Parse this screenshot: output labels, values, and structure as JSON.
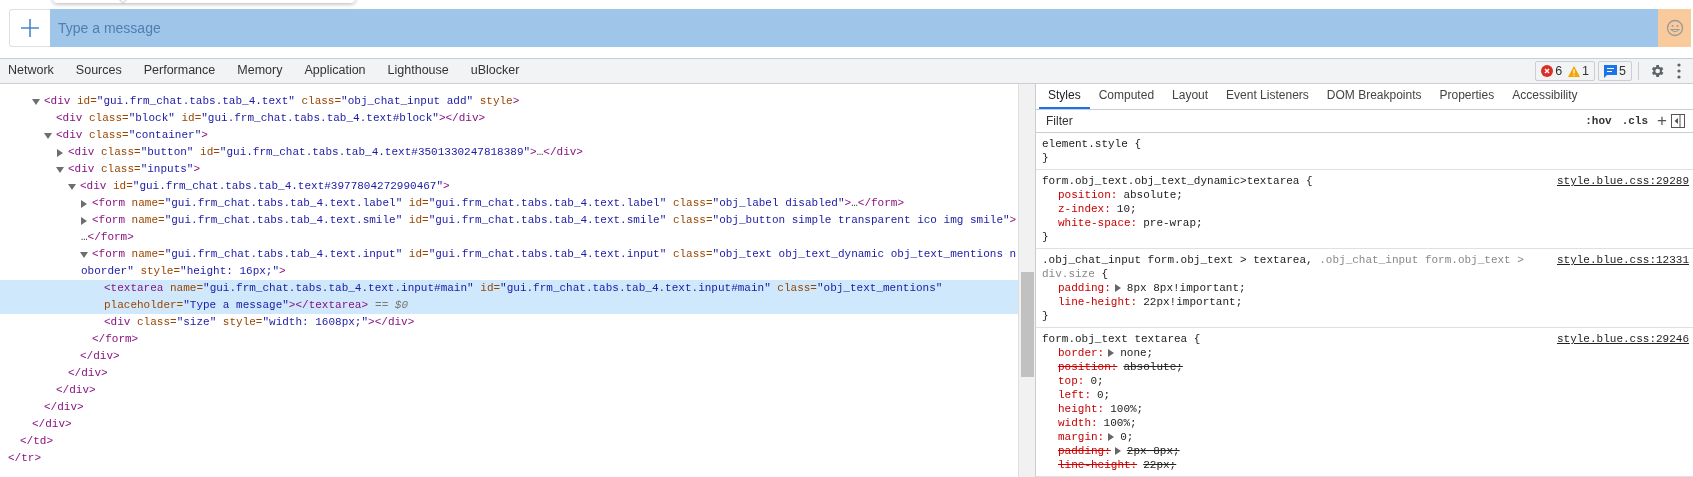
{
  "chat_bar": {
    "placeholder": "Type a message"
  },
  "devtools_tabs": [
    {
      "label": "Network",
      "selected": false
    },
    {
      "label": "Sources",
      "selected": false
    },
    {
      "label": "Performance",
      "selected": false
    },
    {
      "label": "Memory",
      "selected": false
    },
    {
      "label": "Application",
      "selected": false
    },
    {
      "label": "Lighthouse",
      "selected": false
    },
    {
      "label": "uBlocker",
      "selected": false
    }
  ],
  "issues": {
    "errors": "6",
    "warnings": "1",
    "messages": "5"
  },
  "dom_tree": [
    {
      "selected": false,
      "close": [
        [
          {
            "kind": "tag",
            "text": "</tr>"
          }
        ]
      ],
      "children": [
        {
          "selected": false,
          "close": [
            [
              {
                "kind": "tag",
                "text": "</td>"
              }
            ]
          ],
          "children": [
            {
              "selected": false,
              "close": [
                [
                  {
                    "kind": "tag",
                    "text": "</div>"
                  }
                ]
              ],
              "children": [
                {
                  "selected": false,
                  "expanded": true,
                  "open": [
                    [
                      {
                        "kind": "tag",
                        "text": "<div"
                      },
                      {
                        "kind": "attr",
                        "text": " id="
                      },
                      {
                        "kind": "value",
                        "text": "\"gui.frm_chat.tabs.tab_4.text\""
                      },
                      {
                        "kind": "attr",
                        "text": " class="
                      },
                      {
                        "kind": "value",
                        "text": "\"obj_chat_input add\""
                      },
                      {
                        "kind": "attr",
                        "text": " style"
                      },
                      {
                        "kind": "tag",
                        "text": ">"
                      }
                    ]
                  ],
                  "close": [
                    [
                      {
                        "kind": "tag",
                        "text": "</div>"
                      }
                    ]
                  ],
                  "children": [
                    {
                      "selected": false,
                      "open": [
                        [
                          {
                            "kind": "tag",
                            "text": "<div"
                          },
                          {
                            "kind": "attr",
                            "text": " class="
                          },
                          {
                            "kind": "value",
                            "text": "\"block\""
                          },
                          {
                            "kind": "attr",
                            "text": " id="
                          },
                          {
                            "kind": "value",
                            "text": "\"gui.frm_chat.tabs.tab_4.text#block\""
                          },
                          {
                            "kind": "tag",
                            "text": "></div>"
                          }
                        ]
                      ]
                    },
                    {
                      "selected": false,
                      "expanded": true,
                      "open": [
                        [
                          {
                            "kind": "tag",
                            "text": "<div"
                          },
                          {
                            "kind": "attr",
                            "text": " class="
                          },
                          {
                            "kind": "value",
                            "text": "\"container\""
                          },
                          {
                            "kind": "tag",
                            "text": ">"
                          }
                        ]
                      ],
                      "close": [
                        [
                          {
                            "kind": "tag",
                            "text": "</div>"
                          }
                        ]
                      ],
                      "children": [
                        {
                          "selected": false,
                          "expanded": false,
                          "open": [
                            [
                              {
                                "kind": "tag",
                                "text": "<div"
                              },
                              {
                                "kind": "attr",
                                "text": " class="
                              },
                              {
                                "kind": "value",
                                "text": "\"button\""
                              },
                              {
                                "kind": "attr",
                                "text": " id="
                              },
                              {
                                "kind": "value",
                                "text": "\"gui.frm_chat.tabs.tab_4.text#3501330247818389\""
                              },
                              {
                                "kind": "tag",
                                "text": ">"
                              },
                              {
                                "kind": "text",
                                "text": "…"
                              },
                              {
                                "kind": "tag",
                                "text": "</div>"
                              }
                            ]
                          ]
                        },
                        {
                          "selected": false,
                          "expanded": true,
                          "open": [
                            [
                              {
                                "kind": "tag",
                                "text": "<div"
                              },
                              {
                                "kind": "attr",
                                "text": " class="
                              },
                              {
                                "kind": "value",
                                "text": "\"inputs\""
                              },
                              {
                                "kind": "tag",
                                "text": ">"
                              }
                            ]
                          ],
                          "close": [
                            [
                              {
                                "kind": "tag",
                                "text": "</div>"
                              }
                            ]
                          ],
                          "children": [
                            {
                              "selected": false,
                              "expanded": true,
                              "open": [
                                [
                                  {
                                    "kind": "tag",
                                    "text": "<div"
                                  },
                                  {
                                    "kind": "attr",
                                    "text": " id="
                                  },
                                  {
                                    "kind": "value",
                                    "text": "\"gui.frm_chat.tabs.tab_4.text#3977804272990467\""
                                  },
                                  {
                                    "kind": "tag",
                                    "text": ">"
                                  }
                                ]
                              ],
                              "close": [
                                [
                                  {
                                    "kind": "tag",
                                    "text": "</div>"
                                  }
                                ]
                              ],
                              "children": [
                                {
                                  "selected": false,
                                  "expanded": false,
                                  "open": [
                                    [
                                      {
                                        "kind": "tag",
                                        "text": "<form"
                                      },
                                      {
                                        "kind": "attr",
                                        "text": " name="
                                      },
                                      {
                                        "kind": "value",
                                        "text": "\"gui.frm_chat.tabs.tab_4.text.label\""
                                      },
                                      {
                                        "kind": "attr",
                                        "text": " id="
                                      },
                                      {
                                        "kind": "value",
                                        "text": "\"gui.frm_chat.tabs.tab_4.text.label\""
                                      },
                                      {
                                        "kind": "attr",
                                        "text": " class="
                                      },
                                      {
                                        "kind": "value",
                                        "text": "\"obj_label disabled\""
                                      },
                                      {
                                        "kind": "tag",
                                        "text": ">"
                                      },
                                      {
                                        "kind": "text",
                                        "text": "…"
                                      },
                                      {
                                        "kind": "tag",
                                        "text": "</form>"
                                      }
                                    ]
                                  ]
                                },
                                {
                                  "selected": false,
                                  "expanded": false,
                                  "open": [
                                    [
                                      {
                                        "kind": "tag",
                                        "text": "<form"
                                      },
                                      {
                                        "kind": "attr",
                                        "text": " name="
                                      },
                                      {
                                        "kind": "value",
                                        "text": "\"gui.frm_chat.tabs.tab_4.text.smile\""
                                      },
                                      {
                                        "kind": "attr",
                                        "text": " id="
                                      },
                                      {
                                        "kind": "value",
                                        "text": "\"gui.frm_chat.tabs.tab_4.text.smile\""
                                      },
                                      {
                                        "kind": "attr",
                                        "text": " class="
                                      },
                                      {
                                        "kind": "value",
                                        "text": "\"obj_button simple transparent ico img smile\""
                                      },
                                      {
                                        "kind": "tag",
                                        "text": ">"
                                      }
                                    ],
                                    [
                                      {
                                        "kind": "text",
                                        "text": "…"
                                      },
                                      {
                                        "kind": "tag",
                                        "text": "</form>"
                                      }
                                    ]
                                  ]
                                },
                                {
                                  "selected": false,
                                  "expanded": true,
                                  "open": [
                                    [
                                      {
                                        "kind": "tag",
                                        "text": "<form"
                                      },
                                      {
                                        "kind": "attr",
                                        "text": " name="
                                      },
                                      {
                                        "kind": "value",
                                        "text": "\"gui.frm_chat.tabs.tab_4.text.input\""
                                      },
                                      {
                                        "kind": "attr",
                                        "text": " id="
                                      },
                                      {
                                        "kind": "value",
                                        "text": "\"gui.frm_chat.tabs.tab_4.text.input\""
                                      },
                                      {
                                        "kind": "attr",
                                        "text": " class="
                                      },
                                      {
                                        "kind": "value",
                                        "text": "\"obj_text obj_text_dynamic obj_text_mentions n"
                                      }
                                    ],
                                    [
                                      {
                                        "kind": "value",
                                        "text": "oborder\""
                                      },
                                      {
                                        "kind": "attr",
                                        "text": " style="
                                      },
                                      {
                                        "kind": "value",
                                        "text": "\"height: 16px;\""
                                      },
                                      {
                                        "kind": "tag",
                                        "text": ">"
                                      }
                                    ]
                                  ],
                                  "close": [
                                    [
                                      {
                                        "kind": "tag",
                                        "text": "</form>"
                                      }
                                    ]
                                  ],
                                  "children": [
                                    {
                                      "selected": true,
                                      "marker": "== $0",
                                      "open": [
                                        [
                                          {
                                            "kind": "tag",
                                            "text": "<textarea"
                                          },
                                          {
                                            "kind": "attr",
                                            "text": " name="
                                          },
                                          {
                                            "kind": "value",
                                            "text": "\"gui.frm_chat.tabs.tab_4.text.input#main\""
                                          },
                                          {
                                            "kind": "attr",
                                            "text": " id="
                                          },
                                          {
                                            "kind": "value",
                                            "text": "\"gui.frm_chat.tabs.tab_4.text.input#main\""
                                          },
                                          {
                                            "kind": "attr",
                                            "text": " class="
                                          },
                                          {
                                            "kind": "value",
                                            "text": "\"obj_text_mentions\""
                                          }
                                        ],
                                        [
                                          {
                                            "kind": "attr",
                                            "text": "placeholder="
                                          },
                                          {
                                            "kind": "value",
                                            "text": "\"Type a message\""
                                          },
                                          {
                                            "kind": "tag",
                                            "text": "></textarea>"
                                          }
                                        ]
                                      ]
                                    },
                                    {
                                      "selected": false,
                                      "open": [
                                        [
                                          {
                                            "kind": "tag",
                                            "text": "<div"
                                          },
                                          {
                                            "kind": "attr",
                                            "text": " class="
                                          },
                                          {
                                            "kind": "value",
                                            "text": "\"size\""
                                          },
                                          {
                                            "kind": "attr",
                                            "text": " style="
                                          },
                                          {
                                            "kind": "value",
                                            "text": "\"width: 1608px;\""
                                          },
                                          {
                                            "kind": "tag",
                                            "text": "></div>"
                                          }
                                        ]
                                      ]
                                    }
                                  ]
                                }
                              ]
                            }
                          ]
                        }
                      ]
                    }
                  ]
                }
              ]
            }
          ]
        }
      ]
    }
  ],
  "styles_tabs": [
    {
      "label": "Styles",
      "selected": true
    },
    {
      "label": "Computed",
      "selected": false
    },
    {
      "label": "Layout",
      "selected": false
    },
    {
      "label": "Event Listeners",
      "selected": false
    },
    {
      "label": "DOM Breakpoints",
      "selected": false
    },
    {
      "label": "Properties",
      "selected": false
    },
    {
      "label": "Accessibility",
      "selected": false
    }
  ],
  "filter": {
    "placeholder": "Filter",
    "hov": ":hov",
    "cls": ".cls",
    "add": "+"
  },
  "rules": [
    {
      "selector": [
        {
          "text": "element.style",
          "matched": true
        }
      ],
      "open_brace": "{",
      "close_brace": "}"
    },
    {
      "selector": [
        {
          "text": "form.obj_text.obj_text_dynamic>textarea",
          "matched": true
        }
      ],
      "open_brace": "{",
      "close_brace": "}",
      "source": "style.blue.css:29289",
      "properties": [
        {
          "name": "position:",
          "value": "absolute;",
          "expander": false,
          "overridden": false
        },
        {
          "name": "z-index:",
          "value": "10;",
          "expander": false,
          "overridden": false
        },
        {
          "name": "white-space:",
          "value": "pre-wrap;",
          "expander": false,
          "overridden": false
        }
      ]
    },
    {
      "selector": [
        {
          "text": ".obj_chat_input form.obj_text > textarea,",
          "matched": true
        },
        {
          "text": ".obj_chat_input form.obj_text >",
          "matched": false
        },
        {
          "text": "div.size",
          "matched": false
        }
      ],
      "open_brace": "{",
      "close_brace": "}",
      "source": "style.blue.css:12331",
      "properties": [
        {
          "name": "padding:",
          "value": "8px 8px!important;",
          "expander": true,
          "overridden": false
        },
        {
          "name": "line-height:",
          "value": "22px!important;",
          "expander": false,
          "overridden": false
        }
      ]
    },
    {
      "selector": [
        {
          "text": "form.obj_text textarea",
          "matched": true
        }
      ],
      "open_brace": "{",
      "source": "style.blue.css:29246",
      "properties": [
        {
          "name": "border:",
          "value": "none;",
          "expander": true,
          "overridden": false
        },
        {
          "name": "position:",
          "value": "absolute;",
          "expander": false,
          "overridden": true
        },
        {
          "name": "top:",
          "value": "0;",
          "expander": false,
          "overridden": false
        },
        {
          "name": "left:",
          "value": "0;",
          "expander": false,
          "overridden": false
        },
        {
          "name": "height:",
          "value": "100%;",
          "expander": false,
          "overridden": false
        },
        {
          "name": "width:",
          "value": "100%;",
          "expander": false,
          "overridden": false
        },
        {
          "name": "margin:",
          "value": "0;",
          "expander": true,
          "overridden": false
        },
        {
          "name": "padding:",
          "value": "2px 8px;",
          "expander": true,
          "overridden": true
        },
        {
          "name": "line-height:",
          "value": "22px;",
          "expander": false,
          "overridden": true
        }
      ]
    }
  ]
}
